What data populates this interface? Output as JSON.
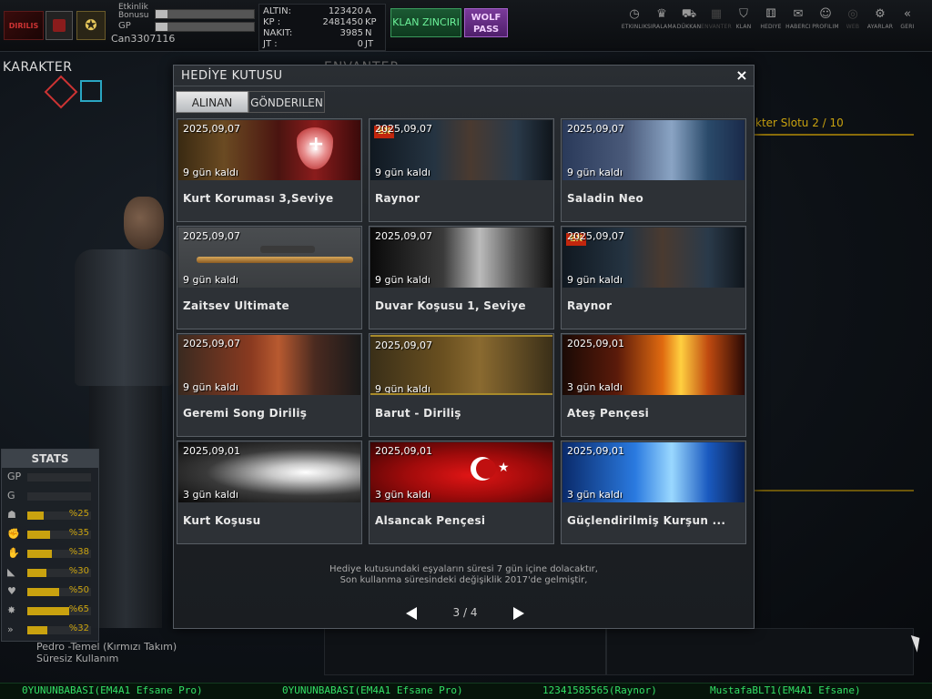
{
  "topbar": {
    "clan_logo_text": "DIRILIS",
    "bonus_label": "Etkinlik Bonusu",
    "bonus_fill": 0.12,
    "gp_label": "GP",
    "gp_fill": 0.12,
    "username": "Can3307116",
    "currency": [
      {
        "label": "ALTIN:",
        "value": "123420",
        "unit": "A"
      },
      {
        "label": "KP :",
        "value": "2481450",
        "unit": "KP"
      },
      {
        "label": "NAKIT:",
        "value": "3985",
        "unit": "N"
      },
      {
        "label": "JT :",
        "value": "0",
        "unit": "JT"
      }
    ],
    "clan_chain_label": "KLAN ZINCIRI",
    "wolf_pass_label": "WOLF PASS",
    "nav": [
      {
        "icon": "clock-icon",
        "glyph": "◷",
        "label": "ETKINLIK"
      },
      {
        "icon": "ranking-icon",
        "glyph": "♛",
        "label": "SIRALAMA"
      },
      {
        "icon": "cart-icon",
        "glyph": "⛟",
        "label": "DÜKKAN"
      },
      {
        "icon": "inventory-icon",
        "glyph": "▦",
        "label": "ENVANTER"
      },
      {
        "icon": "clan-icon",
        "glyph": "⛉",
        "label": "KLAN"
      },
      {
        "icon": "gift-icon",
        "glyph": "⚅",
        "label": "HEDIYE"
      },
      {
        "icon": "megaphone-icon",
        "glyph": "✉",
        "label": "HABERCI"
      },
      {
        "icon": "profile-icon",
        "glyph": "☺",
        "label": "PROFILIM"
      },
      {
        "icon": "web-icon",
        "glyph": "◎",
        "label": "WEB"
      },
      {
        "icon": "settings-icon",
        "glyph": "⚙",
        "label": "AYARLAR"
      },
      {
        "icon": "back-icon",
        "glyph": "«",
        "label": "GERI"
      }
    ]
  },
  "character": {
    "title": "KARAKTER",
    "name_line": "Pedro -Temel (Kırmızı Takım)",
    "usage_line": "Süresiz Kullanım"
  },
  "stats": {
    "title": "STATS",
    "rows": [
      {
        "icon": "gp-icon",
        "glyph": "GP",
        "fill": 0,
        "value": ""
      },
      {
        "icon": "g-icon",
        "glyph": "G",
        "fill": 0,
        "value": ""
      },
      {
        "icon": "helmet-icon",
        "glyph": "☗",
        "fill": 0.25,
        "value": "%25"
      },
      {
        "icon": "fist-icon",
        "glyph": "✊",
        "fill": 0.35,
        "value": "%35"
      },
      {
        "icon": "hand-icon",
        "glyph": "✋",
        "fill": 0.38,
        "value": "%38"
      },
      {
        "icon": "boot-icon",
        "glyph": "◣",
        "fill": 0.3,
        "value": "%30"
      },
      {
        "icon": "heart-icon",
        "glyph": "♥",
        "fill": 0.5,
        "value": "%50"
      },
      {
        "icon": "burst-icon",
        "glyph": "✸",
        "fill": 0.65,
        "value": "%65"
      },
      {
        "icon": "speed-icon",
        "glyph": "»",
        "fill": 0.32,
        "value": "%32"
      }
    ]
  },
  "inventory": {
    "title": "ENVANTER",
    "slot_label": "kter Slotu 2 / 10"
  },
  "modal": {
    "title": "HEDİYE KUTUSU",
    "close": "×",
    "tabs": [
      {
        "label": "ALINAN",
        "active": true
      },
      {
        "label": "GÖNDERILEN",
        "active": false
      }
    ],
    "items": [
      {
        "date": "2025,09,07",
        "days": "9 gün kaldı",
        "name": "Kurt Koruması 3,Seviye",
        "theme": "t-wolf",
        "art": "shield",
        "ex": false
      },
      {
        "date": "2025,09,07",
        "days": "9 gün kaldı",
        "name": "Raynor",
        "theme": "t-raynor",
        "art": "",
        "ex": true
      },
      {
        "date": "2025,09,07",
        "days": "9 gün kaldı",
        "name": "Saladin Neo",
        "theme": "t-saladin",
        "art": "",
        "ex": false
      },
      {
        "date": "2025,09,07",
        "days": "9 gün kaldı",
        "name": "Zaitsev Ultimate",
        "theme": "t-zaitsev",
        "art": "rifle",
        "ex": false
      },
      {
        "date": "2025,09,07",
        "days": "9 gün kaldı",
        "name": "Duvar Koşusu 1, Seviye",
        "theme": "t-wall",
        "art": "",
        "ex": false
      },
      {
        "date": "2025,09,07",
        "days": "9 gün kaldı",
        "name": "Raynor",
        "theme": "t-raynor",
        "art": "",
        "ex": true
      },
      {
        "date": "2025,09,07",
        "days": "9 gün kaldı",
        "name": "Geremi Song Diriliş",
        "theme": "t-geremi",
        "art": "",
        "ex": false
      },
      {
        "date": "2025,09,07",
        "days": "9 gün kaldı",
        "name": "Barut - Diriliş",
        "theme": "t-barut",
        "art": "",
        "ex": false
      },
      {
        "date": "2025,09,01",
        "days": "3 gün kaldı",
        "name": "Ateş Pençesi",
        "theme": "t-fire",
        "art": "",
        "ex": false
      },
      {
        "date": "2025,09,01",
        "days": "3 gün kaldı",
        "name": "Kurt Koşusu",
        "theme": "t-kurt",
        "art": "",
        "ex": false
      },
      {
        "date": "2025,09,01",
        "days": "3 gün kaldı",
        "name": "Alsancak Pençesi",
        "theme": "t-flag",
        "art": "flag",
        "ex": false
      },
      {
        "date": "2025,09,01",
        "days": "3 gün kaldı",
        "name": "Güçlendirilmiş Kurşun ...",
        "theme": "t-bullet",
        "art": "",
        "ex": false
      }
    ],
    "info_line1": "Hediye kutusundaki eşyaların süresi 7 gün içine dolacaktır,",
    "info_line2": "Son kullanma süresindeki değişiklik 2017'de gelmiştir,",
    "page": "3 / 4"
  },
  "ticker": [
    "0YUNUNBABASI(EM4A1 Efsane Pro)",
    "0YUNUNBABASI(EM4A1 Efsane Pro)",
    "12341585565(Raynor)",
    "MustafaBLT1(EM4A1 Efsane)"
  ]
}
